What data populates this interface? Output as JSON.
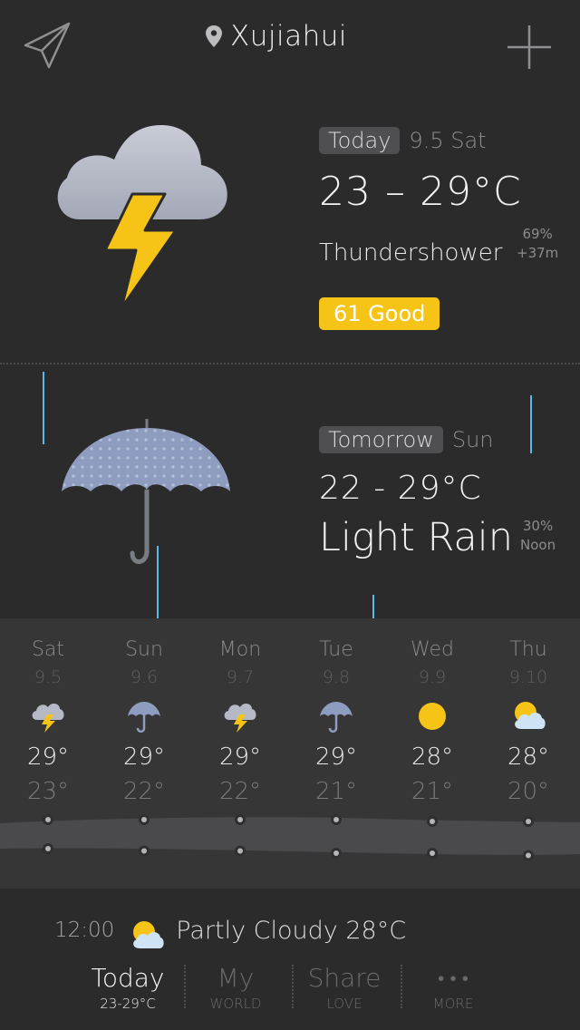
{
  "header": {
    "location": "Xujiahui",
    "send_icon": "paper-plane-icon",
    "add_icon": "plus-icon",
    "pin_icon": "location-pin-icon"
  },
  "today": {
    "label": "Today",
    "date": "9.5 Sat",
    "temp_range": "23 – 29°C",
    "condition": "Thundershower",
    "humidity": "69%",
    "altitude": "+37m",
    "aqi": "61 Good",
    "icon": "thunderstorm-icon"
  },
  "tomorrow": {
    "label": "Tomorrow",
    "date": "Sun",
    "temp_range": "22 - 29°C",
    "condition": "Light Rain",
    "precip": "30%",
    "precip_time": "Noon",
    "icon": "umbrella-icon"
  },
  "forecast": [
    {
      "day": "Sat",
      "date": "9.5",
      "high": "29°",
      "low": "23°",
      "icon": "thunderstorm-icon",
      "high_value": 29,
      "low_value": 23
    },
    {
      "day": "Sun",
      "date": "9.6",
      "high": "29°",
      "low": "22°",
      "icon": "umbrella-icon",
      "high_value": 29,
      "low_value": 22
    },
    {
      "day": "Mon",
      "date": "9.7",
      "high": "29°",
      "low": "22°",
      "icon": "thunderstorm-icon",
      "high_value": 29,
      "low_value": 22
    },
    {
      "day": "Tue",
      "date": "9.8",
      "high": "29°",
      "low": "21°",
      "icon": "umbrella-icon",
      "high_value": 29,
      "low_value": 21
    },
    {
      "day": "Wed",
      "date": "9.9",
      "high": "28°",
      "low": "21°",
      "icon": "sun-icon",
      "high_value": 28,
      "low_value": 21
    },
    {
      "day": "Thu",
      "date": "9.10",
      "high": "28°",
      "low": "20°",
      "icon": "partly-cloudy-icon",
      "high_value": 28,
      "low_value": 20
    }
  ],
  "now": {
    "time": "12:00",
    "text": "Partly Cloudy 28°C",
    "icon": "partly-cloudy-icon"
  },
  "tabs": [
    {
      "main": "Today",
      "sub": "23-29°C",
      "active": true
    },
    {
      "main": "My",
      "sub": "WORLD",
      "active": false
    },
    {
      "main": "Share",
      "sub": "LOVE",
      "active": false
    },
    {
      "main": "• • •",
      "sub": "MORE",
      "active": false
    }
  ],
  "colors": {
    "background": "#2b2b2c",
    "forecast_panel": "#363637",
    "accent_yellow": "#f6c417",
    "rain_blue": "#5ab8ee",
    "pill_gray": "#4f4f51"
  }
}
